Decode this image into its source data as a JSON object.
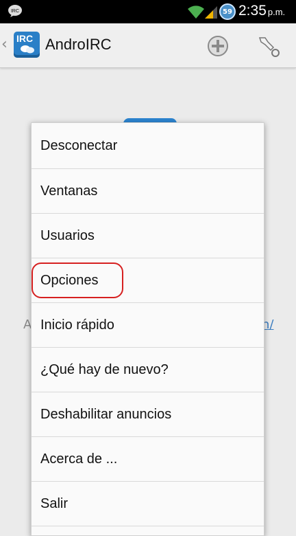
{
  "status_bar": {
    "app_icon_label": "IRC",
    "battery_level": "59",
    "time": "2:35",
    "ampm": "p.m."
  },
  "action_bar": {
    "logo_text": "IRC",
    "title": "AndroIRC"
  },
  "background": {
    "text_a": "A",
    "link_text": "n/"
  },
  "menu": {
    "items": [
      {
        "label": "Desconectar"
      },
      {
        "label": "Ventanas"
      },
      {
        "label": "Usuarios"
      },
      {
        "label": "Opciones",
        "highlighted": true
      },
      {
        "label": "Inicio rápido"
      },
      {
        "label": "¿Qué hay de nuevo?"
      },
      {
        "label": "Deshabilitar anuncios"
      },
      {
        "label": "Acerca de ..."
      },
      {
        "label": "Salir"
      }
    ]
  },
  "colors": {
    "accent": "#2a7fc7",
    "highlight_circle": "#d62020",
    "wifi": "#4caf50",
    "signal": "#f0b400"
  },
  "icons": {
    "status_app": "chat-bubble-icon",
    "wifi": "wifi-icon",
    "signal": "signal-bars-icon",
    "battery": "battery-icon",
    "up": "chevron-left-icon",
    "add": "add-circle-icon",
    "connect": "plug-icon"
  }
}
